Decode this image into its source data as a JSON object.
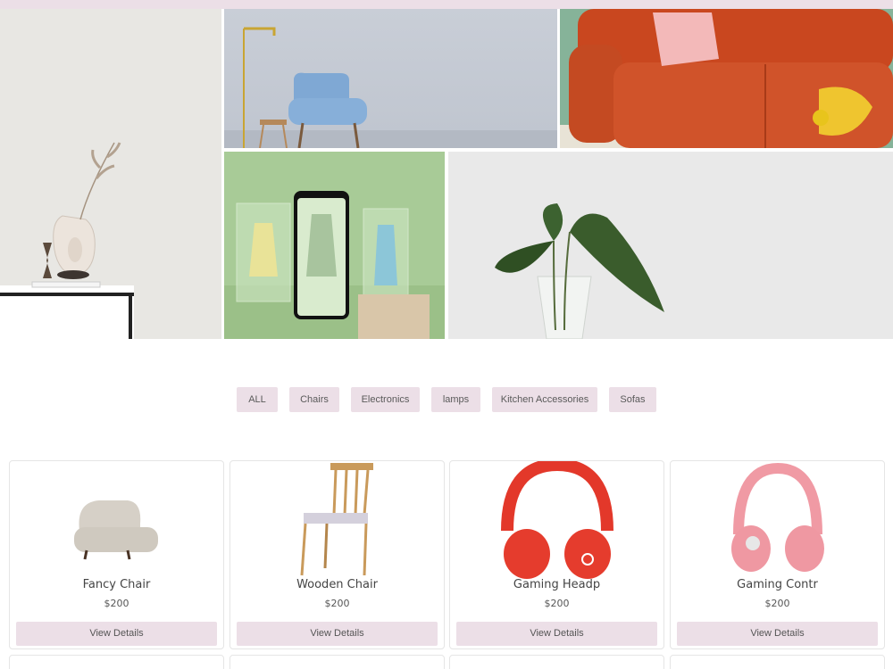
{
  "filters": [
    "ALL",
    "Chairs",
    "Electronics",
    "lamps",
    "Kitchen Accessories",
    "Sofas"
  ],
  "products": [
    {
      "name": "Fancy Chair",
      "price": "$200",
      "button": "View Details",
      "image": "fancy-chair-image"
    },
    {
      "name": "Wooden Chair",
      "price": "$200",
      "button": "View Details",
      "image": "wooden-chair-image"
    },
    {
      "name": "Gaming Headp",
      "price": "$200",
      "button": "View Details",
      "image": "red-headphones-image"
    },
    {
      "name": "Gaming Contr",
      "price": "$200",
      "button": "View Details",
      "image": "pink-headphones-image"
    }
  ],
  "hero_images": [
    "vase-shelf-photo",
    "blue-armchair-photo",
    "orange-sofa-photo",
    "phone-shopping-photo",
    "leaf-vase-photo"
  ],
  "colors": {
    "accent": "#ecdfe7",
    "card_border": "#e5e5e5"
  }
}
